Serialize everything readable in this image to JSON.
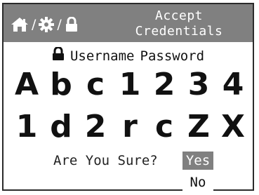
{
  "title": [
    "Accept",
    "Credentials"
  ],
  "breadcrumb": {
    "separator": "/",
    "icons": [
      "home-icon",
      "gear-icon",
      "lock-icon"
    ]
  },
  "fields": {
    "icon": "lock-icon",
    "username_label": "Username",
    "password_label": "Password"
  },
  "characters": {
    "row1": [
      "A",
      "b",
      "c",
      "1",
      "2",
      "3",
      "4"
    ],
    "row2": [
      "1",
      "d",
      "2",
      "r",
      "c",
      "Z",
      "X"
    ]
  },
  "confirm": {
    "question": "Are You Sure?",
    "options": [
      "Yes",
      "No"
    ],
    "selected": "Yes"
  },
  "colors": {
    "header_bg": "#808080",
    "selected_bg": "#808080",
    "border": "#2b2b2b"
  }
}
